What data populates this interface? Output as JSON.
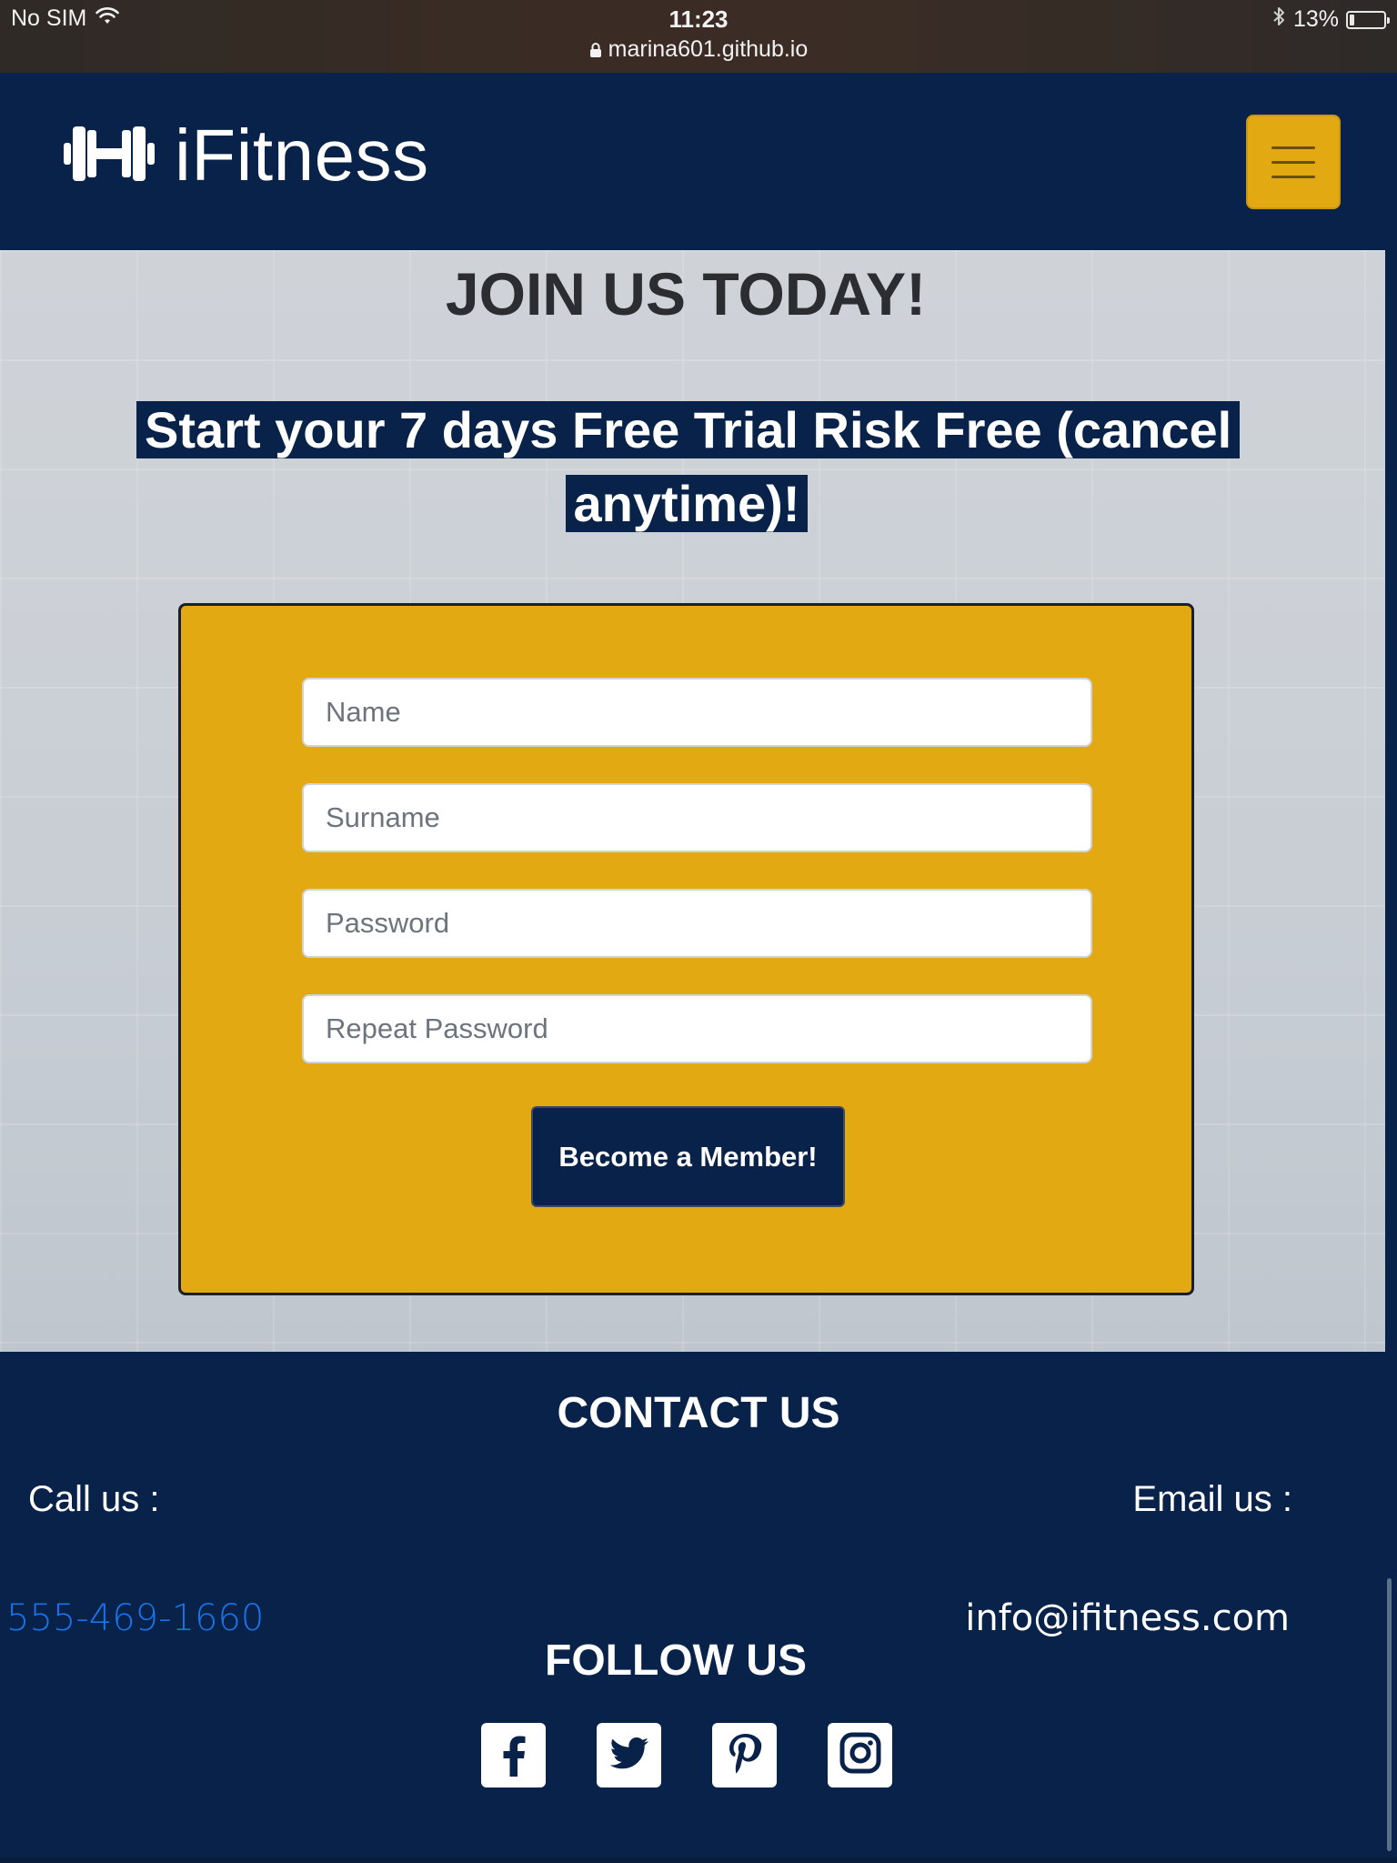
{
  "status_bar": {
    "carrier": "No SIM",
    "time": "11:23",
    "url": "marina601.github.io",
    "battery": "13%"
  },
  "navbar": {
    "brand": "iFitness",
    "menu_icon": "hamburger-menu-icon",
    "brand_icon": "dumbbell-icon"
  },
  "hero": {
    "title": "JOIN US TODAY!",
    "subtitle": "Start your 7 days Free Trial Risk Free (cancel anytime)!"
  },
  "form": {
    "name_placeholder": "Name",
    "surname_placeholder": "Surname",
    "password_placeholder": "Password",
    "repeat_password_placeholder": "Repeat Password",
    "submit_label": "Become a Member!"
  },
  "footer": {
    "contact_title": "CONTACT US",
    "call_label": "Call us :",
    "email_label": "Email us :",
    "phone": "555-469-1660",
    "email": "info@ifitness.com",
    "follow_title": "FOLLOW US",
    "socials": [
      "facebook-icon",
      "twitter-icon",
      "pinterest-icon",
      "instagram-icon"
    ]
  },
  "colors": {
    "navy": "#08224a",
    "gold": "#e2a913",
    "link_blue": "#1a73e8"
  }
}
